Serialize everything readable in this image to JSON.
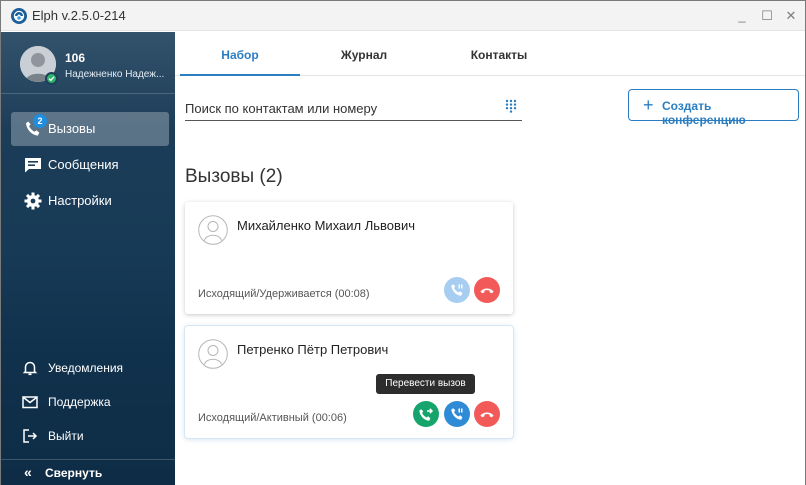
{
  "window": {
    "title": "Elph v.2.5.0-214",
    "minimize": "_",
    "maximize": "☐",
    "close": "✕"
  },
  "profile": {
    "number": "106",
    "name": "Надежненко Надеж..."
  },
  "sidebar": {
    "items": [
      {
        "label": "Вызовы",
        "badge": "2",
        "icon": "phone-icon",
        "active": true
      },
      {
        "label": "Сообщения",
        "icon": "message-icon"
      },
      {
        "label": "Настройки",
        "icon": "gear-icon"
      }
    ],
    "bottom": [
      {
        "label": "Уведомления",
        "icon": "bell-icon"
      },
      {
        "label": "Поддержка",
        "icon": "mail-icon"
      },
      {
        "label": "Выйти",
        "icon": "logout-icon"
      }
    ],
    "collapse": {
      "icon": "«",
      "label": "Свернуть"
    }
  },
  "tabs": [
    {
      "label": "Набор",
      "active": true
    },
    {
      "label": "Журнал"
    },
    {
      "label": "Контакты"
    }
  ],
  "search": {
    "placeholder": "Поиск по контактам или номеру"
  },
  "conference_button": {
    "label": "Создать конференцию",
    "icon": "+"
  },
  "calls": {
    "title": "Вызовы (2)",
    "items": [
      {
        "name": "Михайленко Михаил Львович",
        "status": "Исходящий/Удерживается (00:08)",
        "buttons": [
          "resume-hold-icon",
          "hangup-icon"
        ]
      },
      {
        "name": "Петренко Пётр Петрович",
        "status": "Исходящий/Активный (00:06)",
        "buttons": [
          "transfer-icon",
          "hold-icon",
          "hangup-icon"
        ]
      }
    ]
  },
  "tooltip": {
    "text": "Перевести вызов"
  },
  "colors": {
    "accent": "#2b7dc2",
    "hangup": "#f25a5a",
    "transfer": "#14a46c",
    "hold": "#2f8bd6",
    "presence": "#2fb36b"
  }
}
